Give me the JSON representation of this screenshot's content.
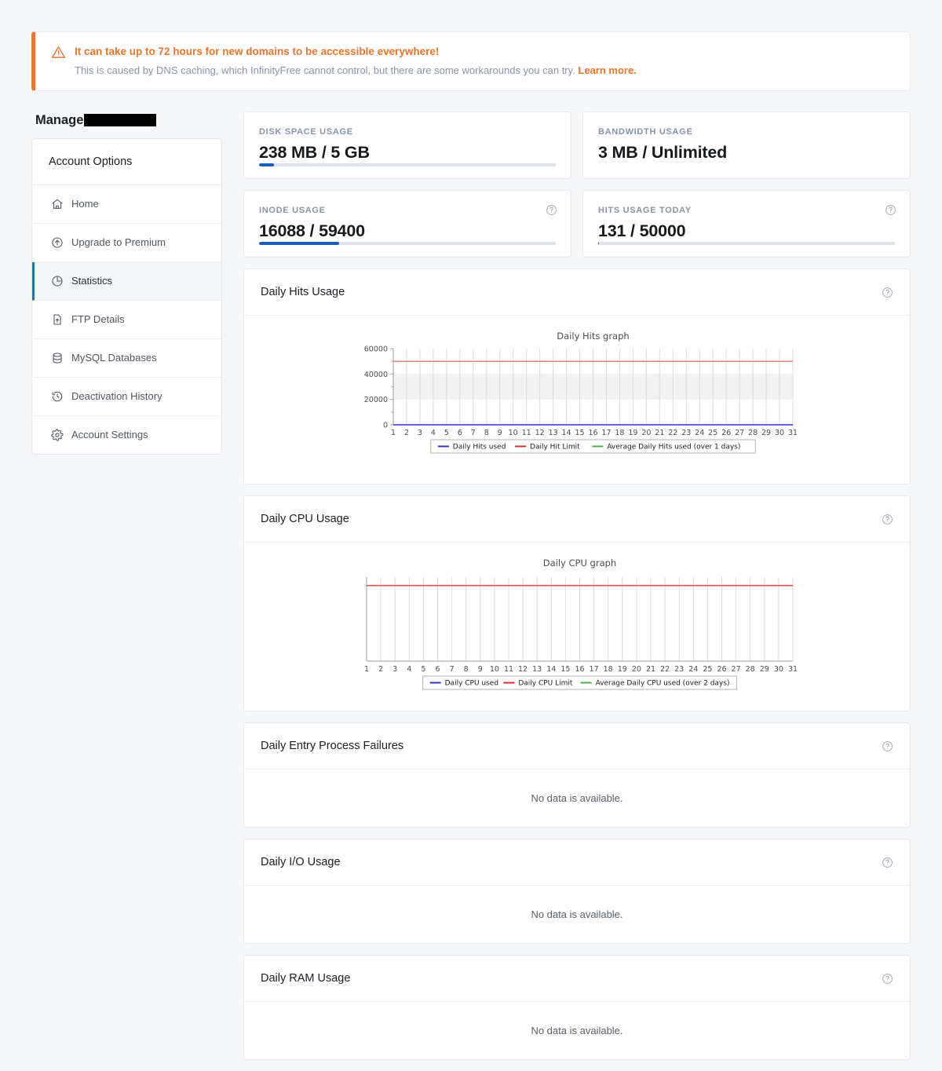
{
  "alert": {
    "icon": "warning-triangle-icon",
    "title": "It can take up to 72 hours for new domains to be accessible everywhere!",
    "body": "This is caused by DNS caching, which InfinityFree cannot control, but there are some workarounds you can try.",
    "link_label": "Learn more.",
    "accent_color": "#e8762c"
  },
  "sidebar": {
    "page_title_prefix": "Manage",
    "page_title_redacted": "",
    "heading": "Account Options",
    "items": [
      {
        "label": "Home",
        "icon": "home-icon",
        "active": false
      },
      {
        "label": "Upgrade to Premium",
        "icon": "arrow-up-circle-icon",
        "active": false
      },
      {
        "label": "Statistics",
        "icon": "pie-chart-icon",
        "active": true
      },
      {
        "label": "FTP Details",
        "icon": "file-upload-icon",
        "active": false
      },
      {
        "label": "MySQL Databases",
        "icon": "database-icon",
        "active": false
      },
      {
        "label": "Deactivation History",
        "icon": "clock-history-icon",
        "active": false
      },
      {
        "label": "Account Settings",
        "icon": "gear-icon",
        "active": false
      }
    ],
    "active_color": "#1d6fd4"
  },
  "stats": [
    {
      "label": "DISK SPACE USAGE",
      "value": "238 MB / 5 GB",
      "progress_percent": 5,
      "has_progress": true,
      "has_help": false
    },
    {
      "label": "BANDWIDTH USAGE",
      "value": "3 MB / Unlimited",
      "progress_percent": 0,
      "has_progress": false,
      "has_help": false
    },
    {
      "label": "INODE USAGE",
      "value": "16088 / 59400",
      "progress_percent": 27,
      "has_progress": true,
      "has_help": true
    },
    {
      "label": "HITS USAGE TODAY",
      "value": "131 / 50000",
      "progress_percent": 0.3,
      "has_progress": true,
      "has_help": true
    }
  ],
  "panels": [
    {
      "title": "Daily Hits Usage",
      "has_help": true,
      "kind": "chart",
      "chart_index": 0
    },
    {
      "title": "Daily CPU Usage",
      "has_help": true,
      "kind": "chart",
      "chart_index": 1
    },
    {
      "title": "Daily Entry Process Failures",
      "has_help": true,
      "kind": "empty",
      "empty_text": "No data is available."
    },
    {
      "title": "Daily I/O Usage",
      "has_help": true,
      "kind": "empty",
      "empty_text": "No data is available."
    },
    {
      "title": "Daily RAM Usage",
      "has_help": true,
      "kind": "empty",
      "empty_text": "No data is available."
    }
  ],
  "chart_data": [
    {
      "type": "line",
      "title": "Daily Hits graph",
      "xlabel": "",
      "ylabel": "",
      "x": [
        1,
        2,
        3,
        4,
        5,
        6,
        7,
        8,
        9,
        10,
        11,
        12,
        13,
        14,
        15,
        16,
        17,
        18,
        19,
        20,
        21,
        22,
        23,
        24,
        25,
        26,
        27,
        28,
        29,
        30,
        31
      ],
      "tick_labels": [
        "1",
        "2",
        "3",
        "4",
        "5",
        "6",
        "7",
        "8",
        "9",
        "10",
        "11",
        "12",
        "13",
        "14",
        "15",
        "16",
        "17",
        "18",
        "19",
        "20",
        "21",
        "22",
        "23",
        "24",
        "25",
        "26",
        "27",
        "28",
        "29",
        "30",
        "31"
      ],
      "ylim": [
        0,
        60000
      ],
      "yticks": [
        0,
        20000,
        40000,
        60000
      ],
      "ytick_labels": [
        "0",
        "20000",
        "40000",
        "60000"
      ],
      "grid": true,
      "legend_position": "bottom",
      "series": [
        {
          "name": "Daily Hits used",
          "color": "#3333cc",
          "values": [
            0,
            0,
            0,
            0,
            0,
            0,
            0,
            0,
            0,
            0,
            0,
            0,
            0,
            0,
            0,
            0,
            0,
            0,
            0,
            0,
            0,
            0,
            0,
            0,
            0,
            0,
            0,
            0,
            0,
            0,
            0
          ]
        },
        {
          "name": "Daily Hit Limit",
          "color": "#cc3333",
          "constant": 50000
        },
        {
          "name": "Average Daily Hits used (over 1  days)",
          "color": "#4caf50",
          "values": []
        }
      ],
      "shaded_band": [
        20000,
        40000
      ]
    },
    {
      "type": "line",
      "title": "Daily CPU graph",
      "xlabel": "",
      "ylabel": "",
      "x": [
        1,
        2,
        3,
        4,
        5,
        6,
        7,
        8,
        9,
        10,
        11,
        12,
        13,
        14,
        15,
        16,
        17,
        18,
        19,
        20,
        21,
        22,
        23,
        24,
        25,
        26,
        27,
        28,
        29,
        30,
        31
      ],
      "tick_labels": [
        "1",
        "2",
        "3",
        "4",
        "5",
        "6",
        "7",
        "8",
        "9",
        "10",
        "11",
        "12",
        "13",
        "14",
        "15",
        "16",
        "17",
        "18",
        "19",
        "20",
        "21",
        "22",
        "23",
        "24",
        "25",
        "26",
        "27",
        "28",
        "29",
        "30",
        "31"
      ],
      "ylim": [
        0,
        1
      ],
      "yticks": [],
      "ytick_labels": [],
      "grid": true,
      "legend_position": "bottom",
      "series": [
        {
          "name": "Daily CPU used",
          "color": "#3333cc",
          "values": []
        },
        {
          "name": "Daily CPU Limit",
          "color": "#e02b2b",
          "constant": 0.9
        },
        {
          "name": "Average Daily CPU used (over 2 days)",
          "color": "#4caf50",
          "values": []
        }
      ]
    }
  ]
}
